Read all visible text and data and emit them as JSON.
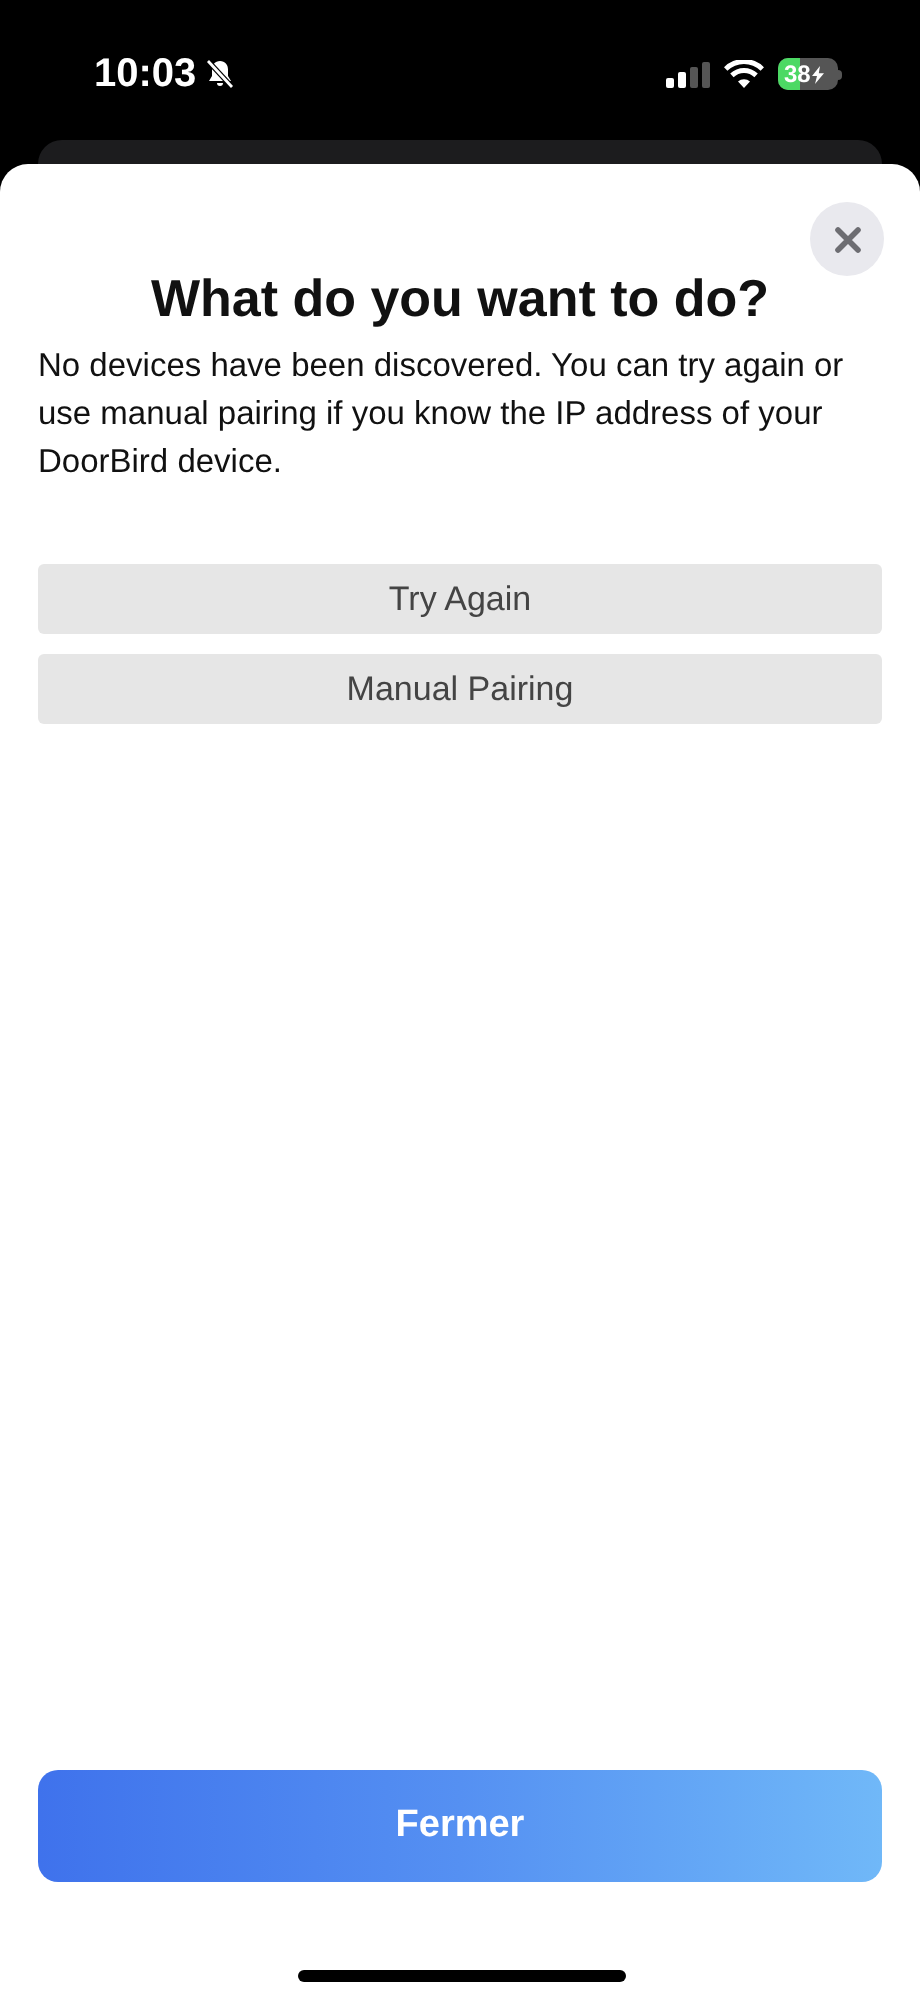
{
  "status_bar": {
    "time": "10:03",
    "battery": "38"
  },
  "sheet": {
    "title": "What do you want to do?",
    "message": "No devices have been discovered. You can try again or use manual pairing if you know the IP address of your DoorBird device.",
    "options": [
      "Try Again",
      "Manual Pairing"
    ],
    "close_button": "Fermer"
  }
}
